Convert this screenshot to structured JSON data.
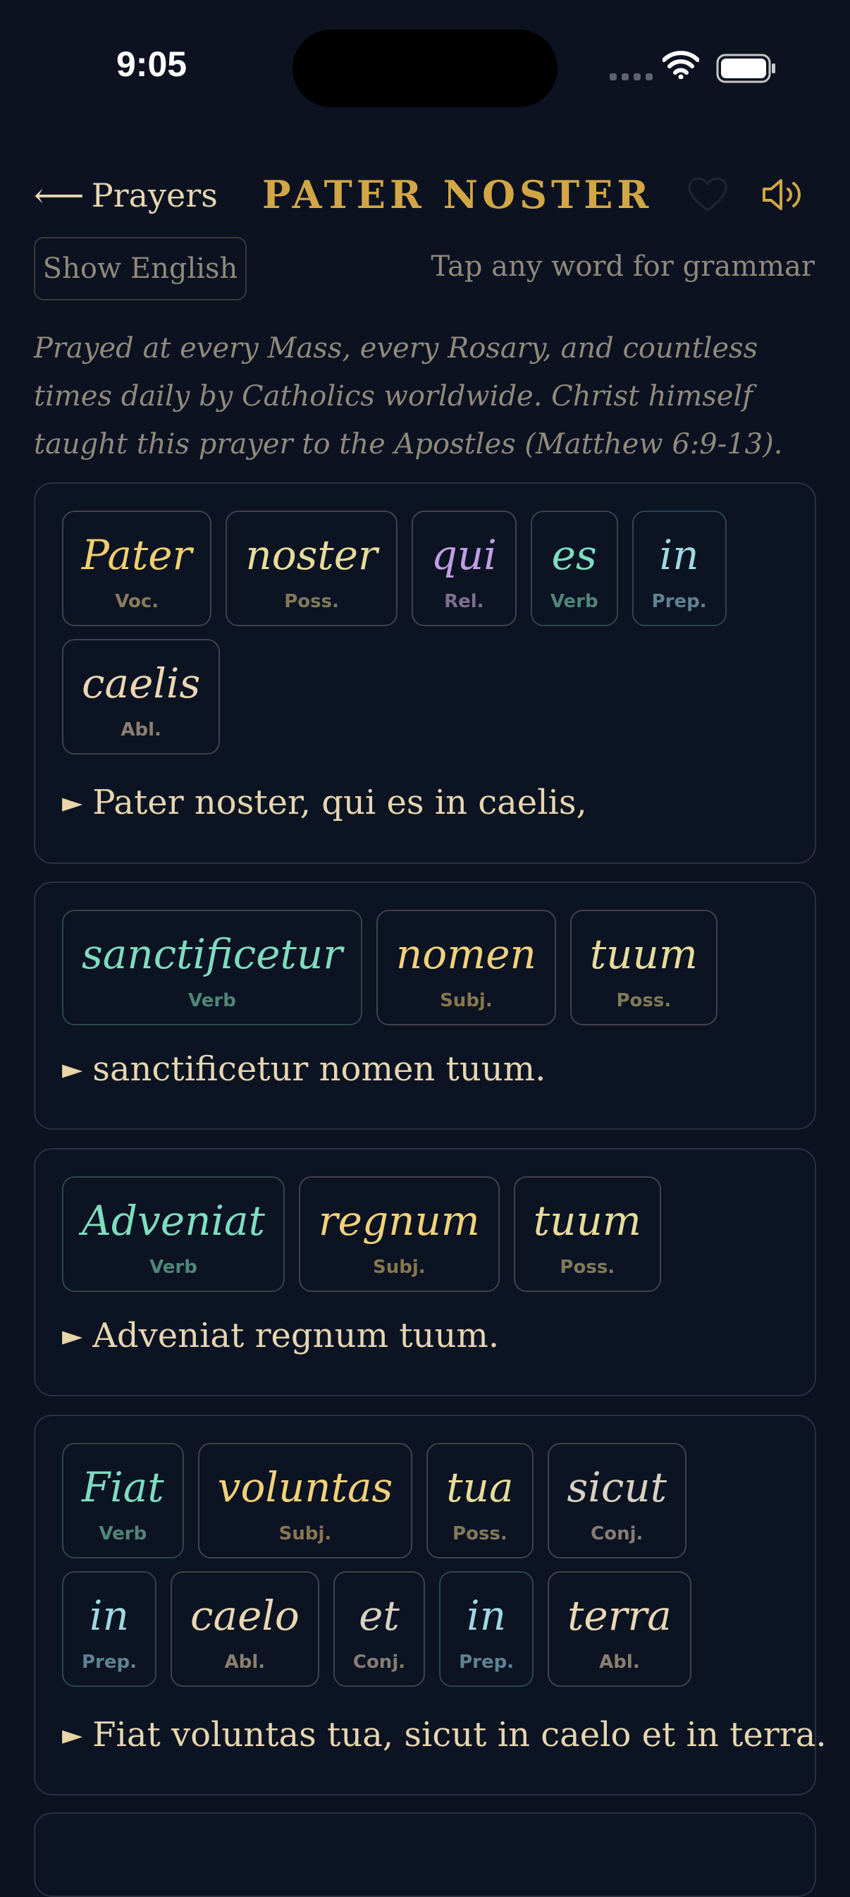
{
  "status": {
    "time": "9:05"
  },
  "nav": {
    "back_label": "Prayers",
    "title": "PATER NOSTER"
  },
  "toolbar": {
    "show_english": "Show English",
    "hint": "Tap any word for grammar"
  },
  "intro": "Prayed at every Mass, every Rosary, and countless times daily by Catholics worldwide. Christ himself taught this prayer to the Apostles (Matthew 6:9-13).",
  "verses": [
    {
      "words": [
        {
          "word": "Pater",
          "tag": "Voc."
        },
        {
          "word": "noster",
          "tag": "Poss."
        },
        {
          "word": "qui",
          "tag": "Rel."
        },
        {
          "word": "es",
          "tag": "Verb"
        },
        {
          "word": "in",
          "tag": "Prep."
        },
        {
          "word": "caelis",
          "tag": "Abl."
        }
      ],
      "line": "Pater noster, qui es in caelis,"
    },
    {
      "words": [
        {
          "word": "sanctificetur",
          "tag": "Verb"
        },
        {
          "word": "nomen",
          "tag": "Subj."
        },
        {
          "word": "tuum",
          "tag": "Poss."
        }
      ],
      "line": "sanctificetur nomen tuum."
    },
    {
      "words": [
        {
          "word": "Adveniat",
          "tag": "Verb"
        },
        {
          "word": "regnum",
          "tag": "Subj."
        },
        {
          "word": "tuum",
          "tag": "Poss."
        }
      ],
      "line": "Adveniat regnum tuum."
    },
    {
      "words": [
        {
          "word": "Fiat",
          "tag": "Verb"
        },
        {
          "word": "voluntas",
          "tag": "Subj."
        },
        {
          "word": "tua",
          "tag": "Poss."
        },
        {
          "word": "sicut",
          "tag": "Conj."
        },
        {
          "word": "in",
          "tag": "Prep."
        },
        {
          "word": "caelo",
          "tag": "Abl."
        },
        {
          "word": "et",
          "tag": "Conj."
        },
        {
          "word": "in",
          "tag": "Prep."
        },
        {
          "word": "terra",
          "tag": "Abl."
        }
      ],
      "line": "Fiat voluntas tua, sicut in caelo et in terra."
    }
  ],
  "colors": {
    "background": "#0c1220",
    "accent_gold": "#d1a645",
    "text_cream": "#e6d6b0",
    "verb_teal": "#7fdcc0",
    "relative_purple": "#c19ee4",
    "preposition_cyan": "#9fd8e2"
  },
  "icons": [
    "back-arrow-icon",
    "heart-icon",
    "speaker-icon",
    "play-icon",
    "wifi-icon",
    "battery-icon",
    "signal-icon"
  ]
}
